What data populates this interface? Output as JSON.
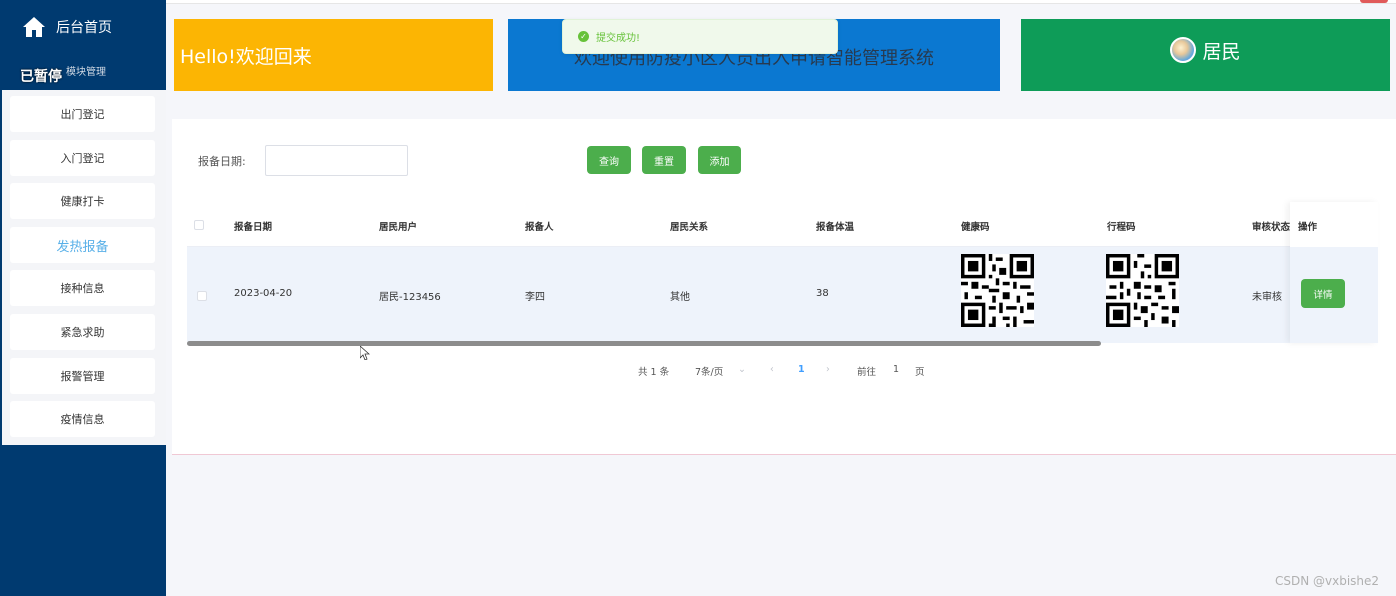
{
  "sidebar": {
    "home_label": "后台首页",
    "module_label": "模块管理",
    "paused_label": "已暂停",
    "items": [
      {
        "label": "出门登记"
      },
      {
        "label": "入门登记"
      },
      {
        "label": "健康打卡"
      },
      {
        "label": "发热报备"
      },
      {
        "label": "接种信息"
      },
      {
        "label": "紧急求助"
      },
      {
        "label": "报警管理"
      },
      {
        "label": "疫情信息"
      }
    ],
    "active_index": 3
  },
  "banners": {
    "welcome": "Hello!欢迎回来",
    "system_title": "欢迎使用防疫小区人员出入申请智能管理系统",
    "role": "居民"
  },
  "toast": {
    "message": "提交成功!"
  },
  "search": {
    "date_label": "报备日期:",
    "date_value": "",
    "query_label": "查询",
    "reset_label": "重置",
    "add_label": "添加"
  },
  "table": {
    "headers": [
      "报备日期",
      "居民用户",
      "报备人",
      "居民关系",
      "报备体温",
      "健康码",
      "行程码",
      "审核状态",
      "操作"
    ],
    "rows": [
      {
        "date": "2023-04-20",
        "user": "居民-123456",
        "reporter": "李四",
        "relation": "其他",
        "temperature": "38",
        "status": "未审核",
        "action_label": "详情"
      }
    ]
  },
  "pagination": {
    "total": "共 1 条",
    "page_size": "7条/页",
    "current_page": "1",
    "goto_prefix": "前往",
    "goto_value": "1",
    "goto_suffix": "页"
  },
  "watermark": "CSDN @vxbishe2",
  "colors": {
    "sidebar_bg": "#003a70",
    "banner_yellow": "#fcb503",
    "banner_blue": "#0b78d1",
    "banner_green": "#0e9c58",
    "button_green": "#4cae4c",
    "active_item": "#59b0e8"
  }
}
